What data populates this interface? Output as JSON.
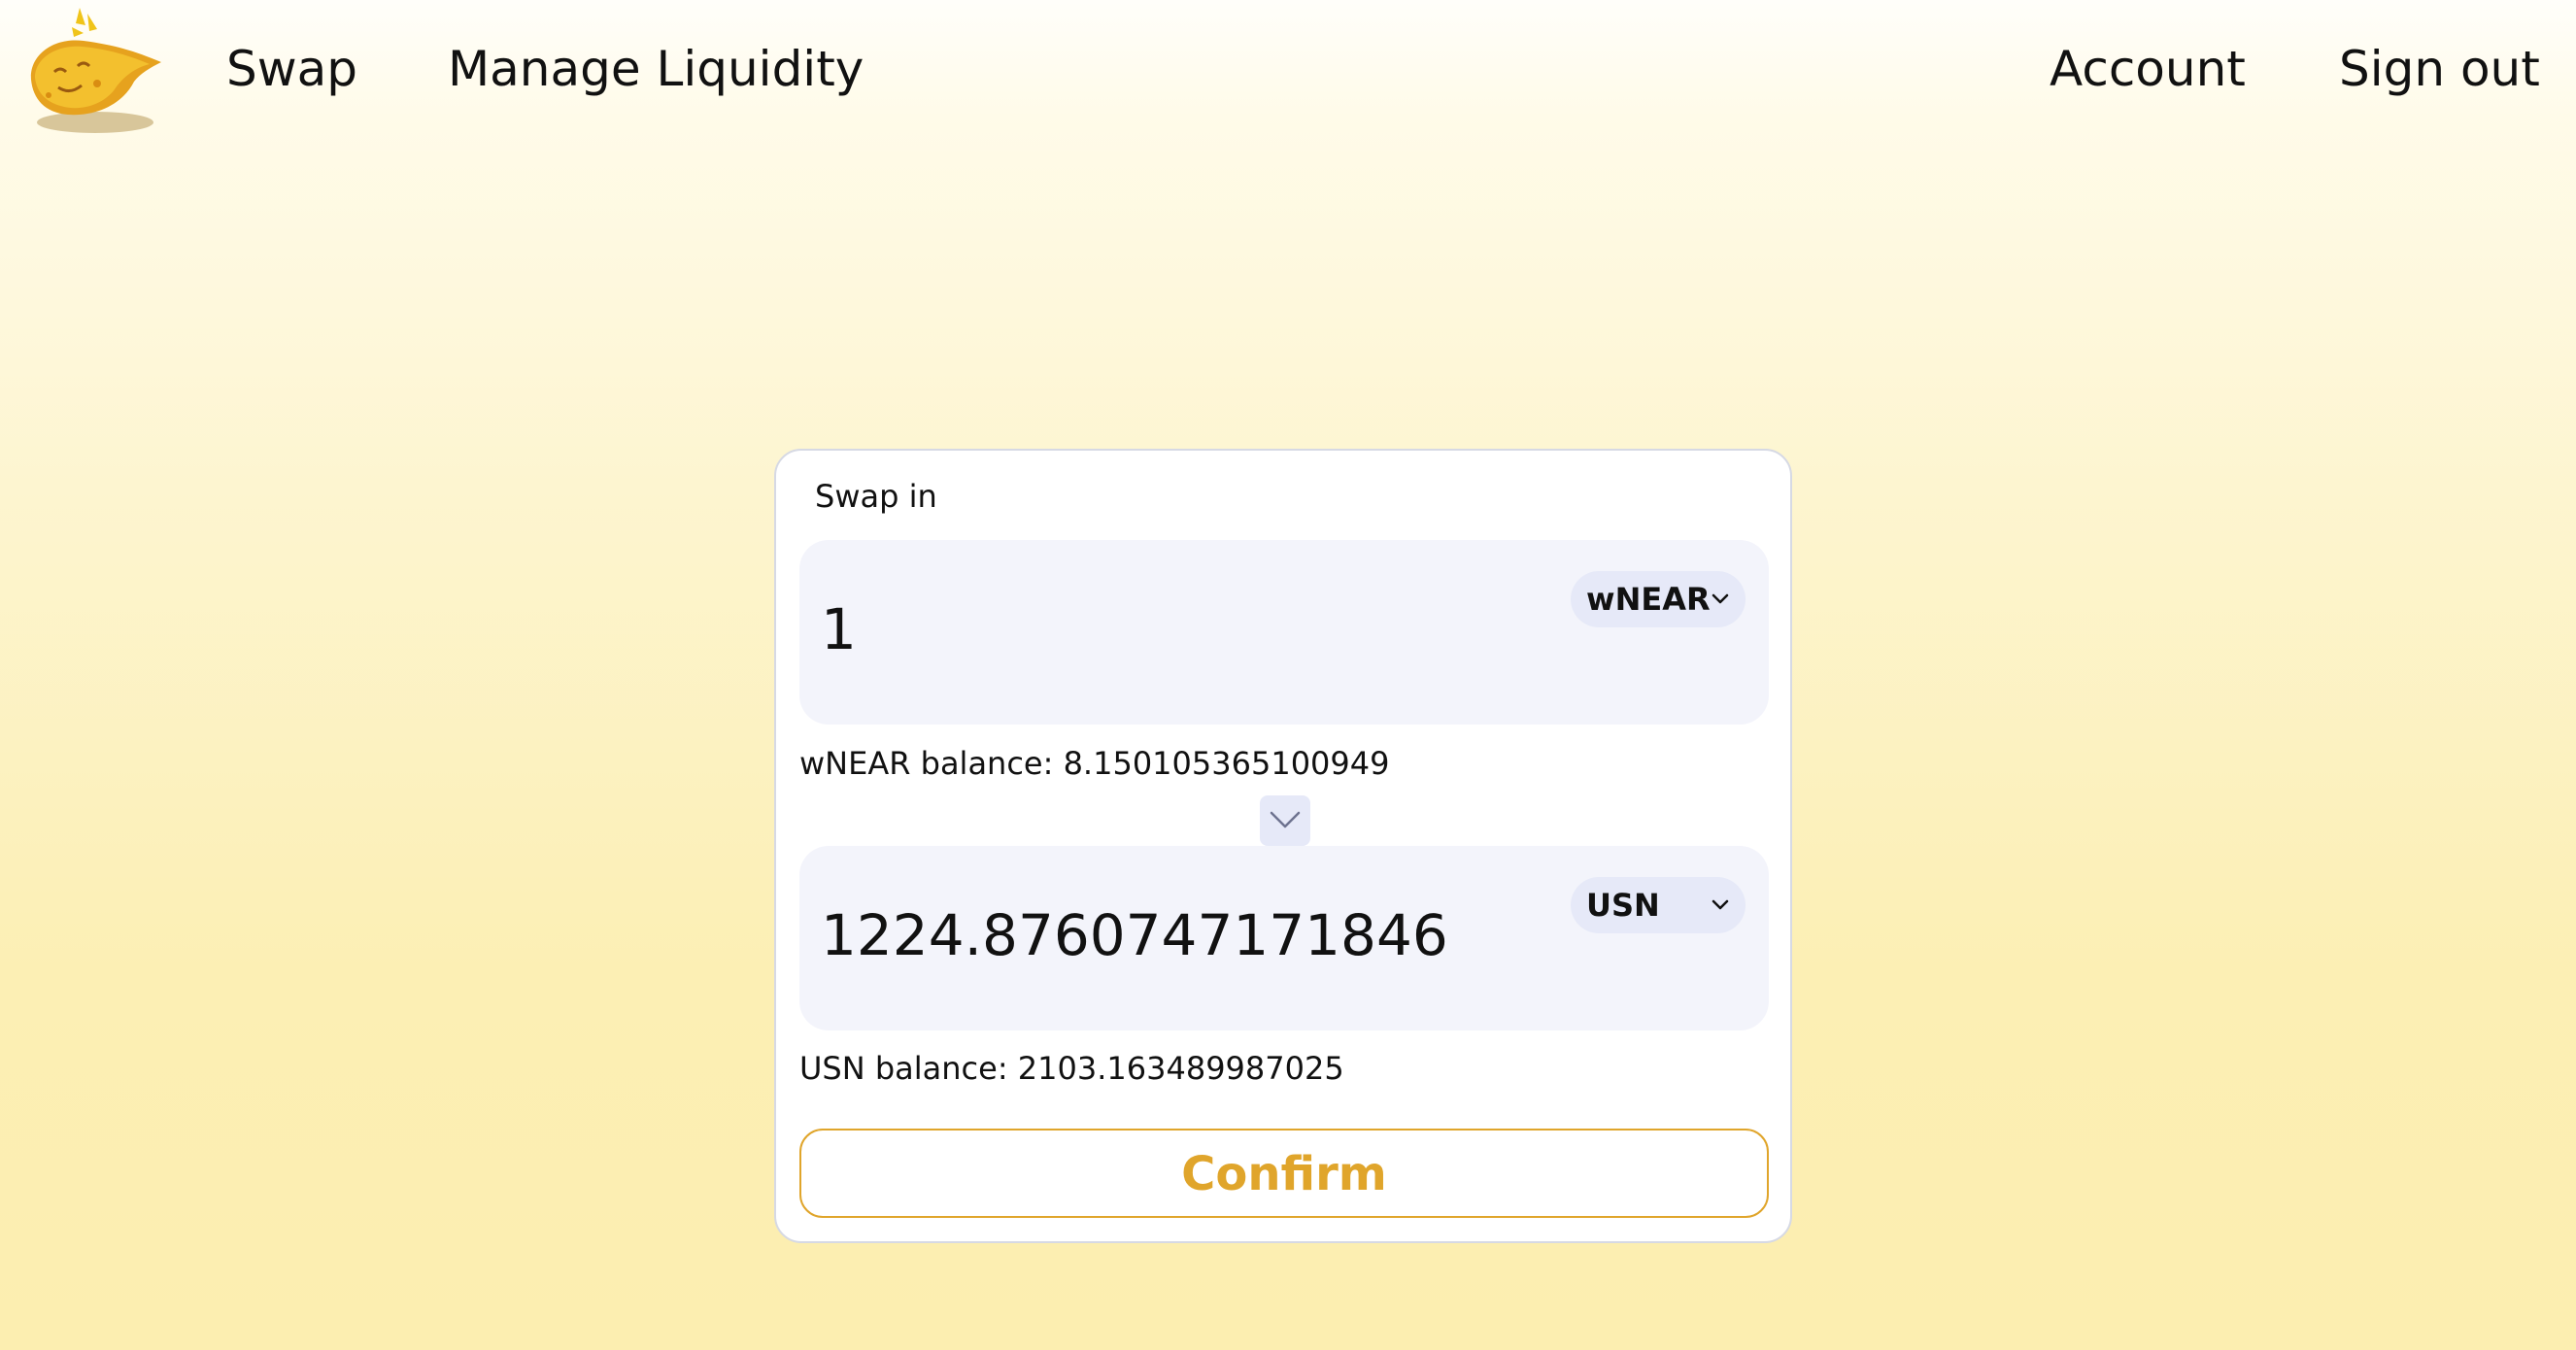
{
  "nav": {
    "logo_icon": "cheese-logo-icon",
    "links": {
      "swap": "Swap",
      "manage_liquidity": "Manage Liquidity",
      "account": "Account",
      "sign_out": "Sign out"
    }
  },
  "swap": {
    "title": "Swap in",
    "input": {
      "amount": "1",
      "token": "wNEAR",
      "balance_text": "wNEAR balance: 8.150105365100949"
    },
    "switch_icon": "chevron-down-icon",
    "output": {
      "amount": "1224.8760747171846",
      "token": "USN",
      "balance_text": "USN balance: 2103.163489987025"
    },
    "confirm_label": "Confirm"
  },
  "colors": {
    "accent": "#e0a52b",
    "card_border": "#d6d9e4",
    "field_bg": "#f3f4fb",
    "token_pill_bg": "#e6e9f8"
  }
}
